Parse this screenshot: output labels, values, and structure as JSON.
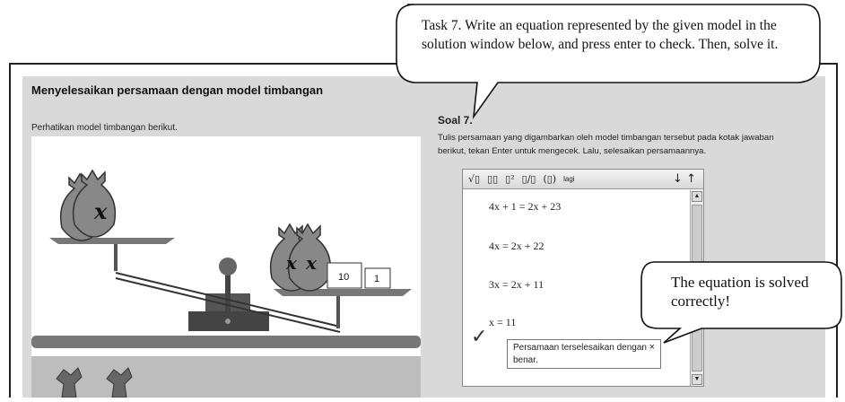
{
  "page": {
    "title": "Menyelesaikan persamaan dengan model timbangan",
    "subtitle": "Perhatikan model timbangan berikut."
  },
  "scale": {
    "bag_label": "x",
    "weight_10": "10",
    "weight_1": "1"
  },
  "task": {
    "heading": "Soal 7.",
    "instruction": "Tulis persamaan yang digambarkan oleh model timbangan tersebut pada kotak jawaban berikut, tekan Enter untuk mengecek. Lalu, selesaikan persamaannya."
  },
  "editor": {
    "toolbar": {
      "sqrt": "√▯",
      "subscript": "▯▯",
      "power": "▯²",
      "fraction": "▯/▯",
      "parens": "(▯)",
      "more": "lagi",
      "down": "↓",
      "up": "↑"
    },
    "lines": [
      "4x + 1 = 2x + 23",
      "4x = 2x + 22",
      "3x = 2x + 11",
      "x = 11"
    ],
    "check_mark": "✓",
    "feedback": "Persamaan terselesaikan dengan benar.",
    "feedback_close": "×"
  },
  "callouts": {
    "task": "Task 7. Write an equation represented by the given model in the solution window below, and press enter to check. Then, solve it.",
    "solved": "The equation is solved correctly!"
  }
}
